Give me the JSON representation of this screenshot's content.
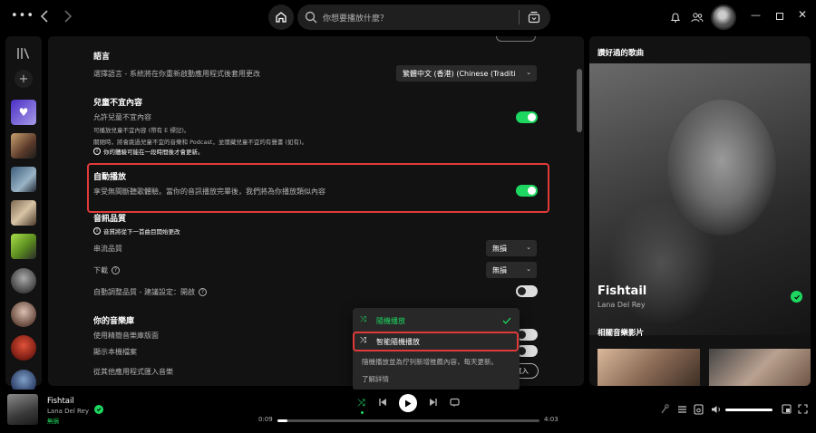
{
  "colors": {
    "accent": "#1ed760",
    "highlight": "#e03a3a",
    "panel": "#121212",
    "background": "#000000"
  },
  "search": {
    "placeholder": "你想要播放什麼？"
  },
  "settings": {
    "language": {
      "title": "語言",
      "desc": "選擇語言 - 系統將在你重新啟動應用程式後套用更改",
      "selected": "繁體中文 (香港) (Chinese (Traditi"
    },
    "explicit": {
      "title": "兒童不宜內容",
      "label": "允許兒童不宜內容",
      "note1": "可播放兒童不宜內容 (帶有 E 標記)。",
      "note2": "關閉時，將會跳過兒童不宜的音樂和 Podcast，並隱藏兒童不宜的有聲書 (如有)。",
      "note3": "你的體驗可能在一段時間後才會更新。",
      "enabled": true
    },
    "autoplay": {
      "title": "自動播放",
      "desc": "享受無間斷聽歌體驗。當你的音訊播放完畢後，我們將為你播放類似內容",
      "enabled": true
    },
    "audio_quality": {
      "title": "音訊品質",
      "note": "音質將從下一首曲目開始更改",
      "stream_label": "串流品質",
      "stream_value": "無損",
      "download_label": "下載",
      "download_value": "無損",
      "auto_label": "自動調整品質 - 建議設定：開啟",
      "auto_enabled": false
    },
    "library": {
      "title": "你的音樂庫",
      "compact_label": "使用精簡音樂庫版面",
      "local_label": "顯示本機檔案",
      "import_label": "從其他應用程式匯入音樂",
      "import_button": "匯入"
    }
  },
  "context_menu": {
    "items": [
      {
        "label": "隨機播放",
        "checked": true
      },
      {
        "label": "智能隨機播放",
        "checked": false
      }
    ],
    "description": "隨機播放並為佇列新增推薦內容，每天更新。",
    "learn_more": "了解詳情"
  },
  "right_panel": {
    "header": "讚好過的歌曲",
    "track_title": "Fishtail",
    "artist": "Lana Del Rey",
    "videos_header": "相關音樂影片"
  },
  "player": {
    "track_title": "Fishtail",
    "artist": "Lana Del Rey",
    "quality_badge": "無損",
    "elapsed": "0:09",
    "duration": "4:03",
    "progress": 0.037,
    "volume": 1.0
  }
}
